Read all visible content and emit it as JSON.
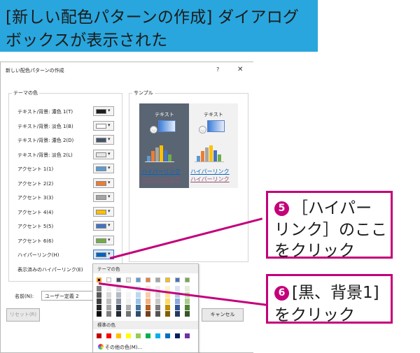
{
  "header": {
    "line1": "[新しい配色パターンの作成] ダイアログ",
    "line2": "ボックスが表示された",
    "bg_color": "#29a6dd"
  },
  "dialog": {
    "title": "新しい配色パターンの作成",
    "help": "?",
    "close": "✕",
    "theme_group_label": "テーマの色",
    "sample_group_label": "サンプル",
    "theme_rows": [
      {
        "label": "テキスト/背景: 濃色 1(T)",
        "color": "#1f1f1f"
      },
      {
        "label": "テキスト/背景: 淡色 1(B)",
        "color": "#ffffff"
      },
      {
        "label": "テキスト/背景: 濃色 2(D)",
        "color": "#44546a"
      },
      {
        "label": "テキスト/背景: 淡色 2(L)",
        "color": "#e7e6e6"
      },
      {
        "label": "アクセント 1(1)",
        "color": "#5b9bd5"
      },
      {
        "label": "アクセント 2(2)",
        "color": "#ed7d31"
      },
      {
        "label": "アクセント 3(3)",
        "color": "#a5a5a5"
      },
      {
        "label": "アクセント 4(4)",
        "color": "#ffc000"
      },
      {
        "label": "アクセント 5(5)",
        "color": "#4472c4"
      },
      {
        "label": "アクセント 6(6)",
        "color": "#70ad47"
      },
      {
        "label": "ハイパーリンク(H)",
        "color": "#0563c1"
      },
      {
        "label": "表示済みのハイパーリンク(E)",
        "color": "#954f72"
      }
    ],
    "sample": {
      "text_dark": "テキスト",
      "text_light": "テキスト",
      "link": "ハイパーリンク",
      "visited_link": "ハイパーリンク"
    },
    "name_label": "名前(N):",
    "name_value": "ユーザー定義 2",
    "reset_label": "リセット(R)",
    "cancel_label": "キャンセル"
  },
  "color_popup": {
    "theme_header": "テーマの色",
    "standard_header": "標準の色",
    "more_colors": "その他の色(M)...",
    "theme_top": [
      "#000000",
      "#ffffff",
      "#44546a",
      "#e7e6e6",
      "#5b9bd5",
      "#ed7d31",
      "#a5a5a5",
      "#ffc000",
      "#4472c4",
      "#70ad47"
    ],
    "standard": [
      "#c00000",
      "#ff0000",
      "#ffc000",
      "#ffff00",
      "#92d050",
      "#00b050",
      "#00b0f0",
      "#0070c0",
      "#002060",
      "#7030a0"
    ]
  },
  "callouts": [
    {
      "number": "5",
      "lines": [
        "［ハイパー",
        "リンク］のここ",
        "をクリック"
      ]
    },
    {
      "number": "6",
      "lines": [
        "[黒、背景1]",
        "をクリック"
      ]
    }
  ],
  "accent_color": "#c4007a"
}
